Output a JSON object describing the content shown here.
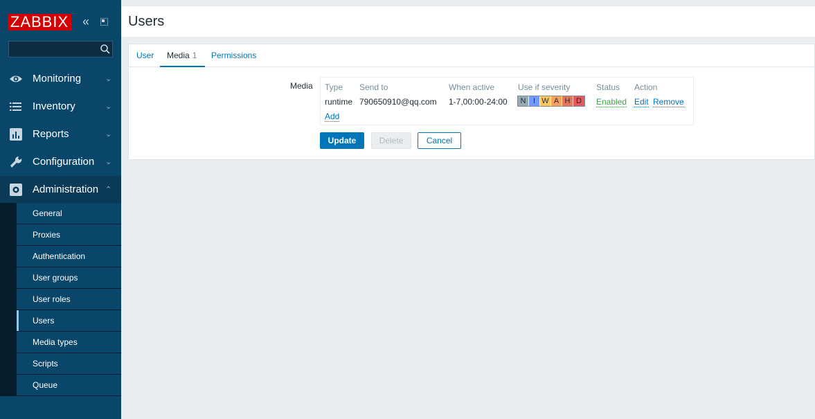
{
  "app": {
    "logo_text": "ZABBIX",
    "brand_color": "#d40000",
    "search": {
      "value": "",
      "placeholder": ""
    }
  },
  "sidebar": {
    "menu": [
      {
        "label": "Monitoring",
        "icon": "eye-icon",
        "expanded": false
      },
      {
        "label": "Inventory",
        "icon": "list-icon",
        "expanded": false
      },
      {
        "label": "Reports",
        "icon": "bar-chart-icon",
        "expanded": false
      },
      {
        "label": "Configuration",
        "icon": "wrench-icon",
        "expanded": false
      },
      {
        "label": "Administration",
        "icon": "gear-icon",
        "expanded": true
      }
    ],
    "submenu": [
      {
        "label": "General"
      },
      {
        "label": "Proxies"
      },
      {
        "label": "Authentication"
      },
      {
        "label": "User groups"
      },
      {
        "label": "User roles"
      },
      {
        "label": "Users",
        "selected": true
      },
      {
        "label": "Media types"
      },
      {
        "label": "Scripts"
      },
      {
        "label": "Queue"
      }
    ]
  },
  "header": {
    "title": "Users"
  },
  "tabs": {
    "user": "User",
    "media": "Media",
    "media_count": "1",
    "permissions": "Permissions",
    "active": "Media"
  },
  "media": {
    "label": "Media",
    "columns": [
      "Type",
      "Send to",
      "When active",
      "Use if severity",
      "Status",
      "Action"
    ],
    "rows": [
      {
        "type": "runtime",
        "send_to": "790650910@qq.com",
        "when_active": "1-7,00:00-24:00",
        "severities": [
          {
            "letter": "N",
            "color": "#97aab3"
          },
          {
            "letter": "I",
            "color": "#7499ff"
          },
          {
            "letter": "W",
            "color": "#ffc859"
          },
          {
            "letter": "A",
            "color": "#ffa059"
          },
          {
            "letter": "H",
            "color": "#e97659"
          },
          {
            "letter": "D",
            "color": "#e45959"
          }
        ],
        "status": "Enabled",
        "edit": "Edit",
        "remove": "Remove"
      }
    ],
    "add_link": "Add"
  },
  "buttons": {
    "update": "Update",
    "delete": "Delete",
    "cancel": "Cancel"
  }
}
